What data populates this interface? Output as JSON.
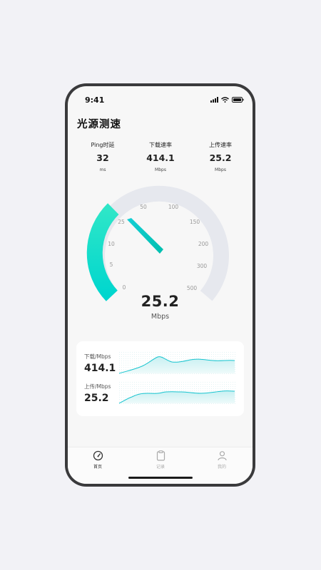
{
  "status_bar": {
    "time": "9:41"
  },
  "page": {
    "title": "光源测速"
  },
  "stats": [
    {
      "label": "Ping时延",
      "value": "32",
      "unit": "ms"
    },
    {
      "label": "下载速率",
      "value": "414.1",
      "unit": "Mbps"
    },
    {
      "label": "上传速率",
      "value": "25.2",
      "unit": "Mbps"
    }
  ],
  "gauge": {
    "value": "25.2",
    "unit": "Mbps",
    "needle_value": 25.2,
    "ticks": [
      "0",
      "5",
      "10",
      "25",
      "50",
      "100",
      "150",
      "200",
      "300",
      "500"
    ],
    "colors": {
      "track": "#e6e8ee",
      "fill_start": "#00d6ce",
      "fill_end": "#2ee6c8",
      "label": "#999999"
    }
  },
  "charts": {
    "download": {
      "label": "下载/Mbps",
      "value": "414.1"
    },
    "upload": {
      "label": "上传/Mbps",
      "value": "25.2"
    },
    "colors": {
      "line": "#18c4cf",
      "fill": "#d7f5f6"
    }
  },
  "tabs": [
    {
      "label": "首页",
      "icon": "speedometer-icon",
      "active": true
    },
    {
      "label": "记录",
      "icon": "clipboard-icon",
      "active": false
    },
    {
      "label": "我的",
      "icon": "person-icon",
      "active": false
    }
  ]
}
